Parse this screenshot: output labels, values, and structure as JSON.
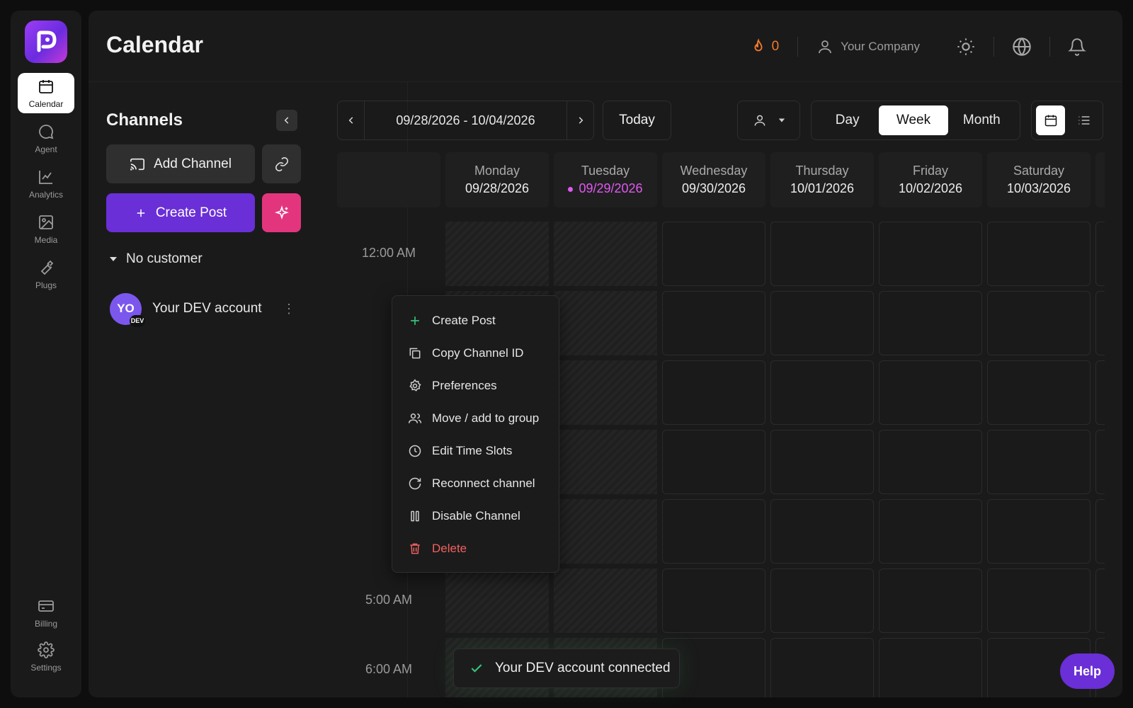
{
  "nav": {
    "items": [
      {
        "label": "Calendar",
        "icon": "calendar-icon"
      },
      {
        "label": "Agent",
        "icon": "chat-bubble-icon"
      },
      {
        "label": "Analytics",
        "icon": "line-chart-icon"
      },
      {
        "label": "Media",
        "icon": "image-icon"
      },
      {
        "label": "Plugs",
        "icon": "wrench-icon"
      }
    ],
    "bottom_items": [
      {
        "label": "Billing",
        "icon": "credit-card-icon"
      },
      {
        "label": "Settings",
        "icon": "gear-icon"
      }
    ]
  },
  "header": {
    "title": "Calendar",
    "streak_count": "0",
    "company": "Your Company"
  },
  "channels": {
    "title": "Channels",
    "add_channel_label": "Add Channel",
    "create_post_label": "Create Post",
    "customer_group": "No customer",
    "account": {
      "initials": "YO",
      "badge": "DEV",
      "name": "Your DEV account"
    }
  },
  "toolbar": {
    "date_range": "09/28/2026 - 10/04/2026",
    "today_label": "Today",
    "views": [
      "Day",
      "Week",
      "Month"
    ],
    "active_view": "Week"
  },
  "calendar": {
    "days": [
      {
        "name": "Monday",
        "date": "09/28/2026"
      },
      {
        "name": "Tuesday",
        "date": "09/29/2026"
      },
      {
        "name": "Wednesday",
        "date": "09/30/2026"
      },
      {
        "name": "Thursday",
        "date": "10/01/2026"
      },
      {
        "name": "Friday",
        "date": "10/02/2026"
      },
      {
        "name": "Saturday",
        "date": "10/03/2026"
      }
    ],
    "visible_times": [
      "12:00 AM",
      "5:00 AM",
      "6:00 AM"
    ],
    "today_color": "#e059f0"
  },
  "menu": {
    "items": [
      {
        "label": "Create Post",
        "icon": "plus-icon"
      },
      {
        "label": "Copy Channel ID",
        "icon": "copy-icon"
      },
      {
        "label": "Preferences",
        "icon": "gear-icon"
      },
      {
        "label": "Move / add to group",
        "icon": "users-icon"
      },
      {
        "label": "Edit Time Slots",
        "icon": "clock-icon"
      },
      {
        "label": "Reconnect channel",
        "icon": "refresh-icon"
      },
      {
        "label": "Disable Channel",
        "icon": "pause-icon"
      },
      {
        "label": "Delete",
        "icon": "trash-icon"
      }
    ]
  },
  "toast": {
    "message": "Your DEV account connected"
  },
  "help_label": "Help",
  "colors": {
    "accent": "#6a2fd6",
    "ai_button": "#e3357e",
    "streak": "#f47a2a",
    "danger": "#f06060",
    "success": "#36c47c"
  }
}
